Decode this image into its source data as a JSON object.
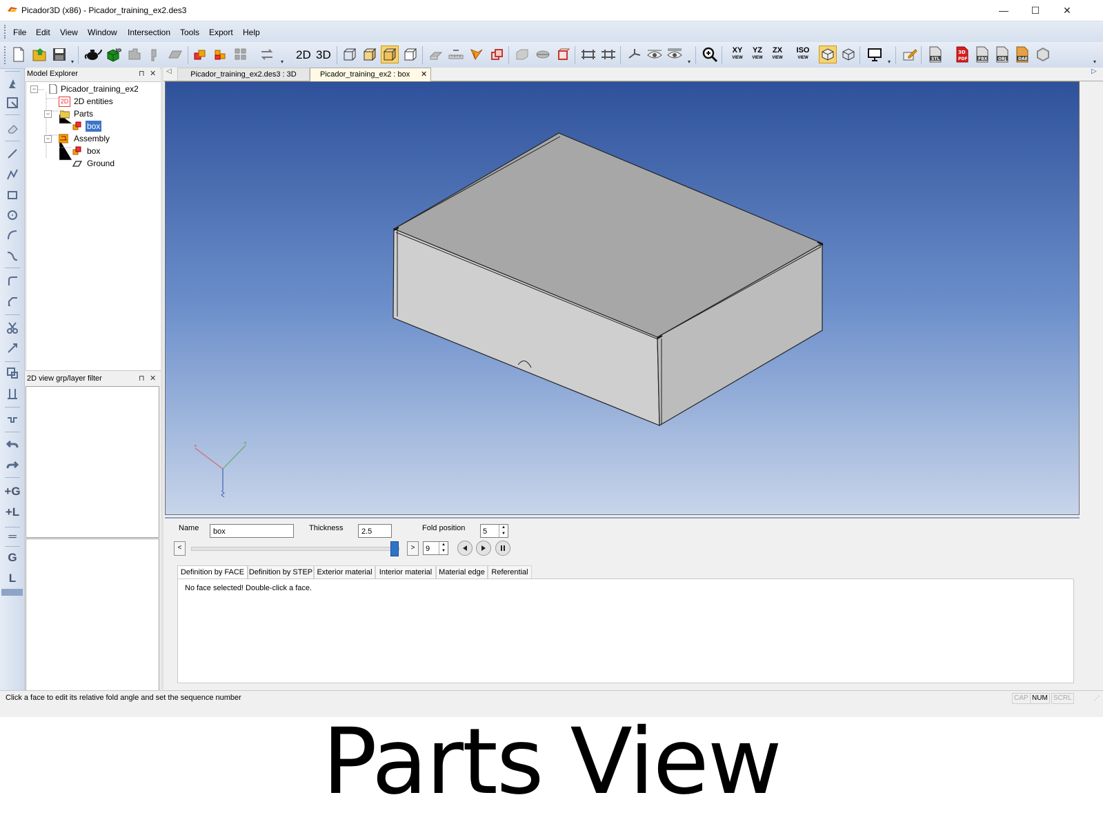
{
  "window": {
    "title": "Picador3D (x86) - Picador_training_ex2.des3",
    "minimize": "—",
    "maximize": "☐",
    "close": "✕"
  },
  "menu": [
    "File",
    "Edit",
    "View",
    "Window",
    "Intersection",
    "Tools",
    "Export",
    "Help"
  ],
  "toolbar": {
    "mode_2d": "2D",
    "mode_3d": "3D",
    "views": [
      {
        "main": "XY",
        "sub": "VIEW"
      },
      {
        "main": "YZ",
        "sub": "VIEW"
      },
      {
        "main": "ZX",
        "sub": "VIEW"
      },
      {
        "main": "ISO",
        "sub": "VIEW"
      }
    ],
    "exports": [
      "STL",
      "PDF",
      "FBX",
      "OBJ",
      "DAE"
    ],
    "pdf_badge": "3D"
  },
  "left_toolbar": {
    "group_g": "G",
    "group_l": "L",
    "add_g": "+G",
    "add_l": "+L"
  },
  "model_explorer": {
    "title": "Model Explorer",
    "pin": "⊓",
    "close": "✕",
    "tree": [
      {
        "label": "Picador_training_ex2",
        "expander": "−"
      },
      {
        "label": "2D entities",
        "badge": "2D"
      },
      {
        "label": "Parts",
        "expander": "−"
      },
      {
        "label": "box",
        "selected": true
      },
      {
        "label": "Assembly",
        "expander": "−"
      },
      {
        "label": "box"
      },
      {
        "label": "Ground"
      }
    ]
  },
  "layer_filter": {
    "title": "2D view grp/layer filter",
    "pin": "⊓",
    "close": "✕"
  },
  "doc_tabs": {
    "left_arrow": "◁",
    "right_arrow": "▷",
    "tabs": [
      {
        "label": "Picador_training_ex2.des3 : 3D",
        "active": false
      },
      {
        "label": "Picador_training_ex2 : box",
        "active": true,
        "close": "✕"
      }
    ]
  },
  "properties": {
    "name_label": "Name",
    "name_value": "box",
    "thickness_label": "Thickness",
    "thickness_value": "2.5",
    "fold_position_label": "Fold position",
    "fold_position_value": "5",
    "sequence_value": "9",
    "slider_left": "<",
    "slider_right": ">",
    "slider_level": 1.0,
    "tabs": [
      "Definition by FACE",
      "Definition by STEP",
      "Exterior material",
      "Interior material",
      "Material edge",
      "Referential"
    ],
    "active_tab": "Definition by FACE",
    "message": "No face selected! Double-click a face."
  },
  "status": {
    "text": "Click a face to edit its relative fold angle and set the sequence number",
    "indicators": [
      "CAP",
      "NUM",
      "SCRL"
    ]
  },
  "caption": "Parts View",
  "colors": {
    "viewport_top": "#2e519b",
    "viewport_bottom": "#c8d5ea",
    "selection": "#3c74c8",
    "toolbar_bg": "#d6e0ee"
  }
}
